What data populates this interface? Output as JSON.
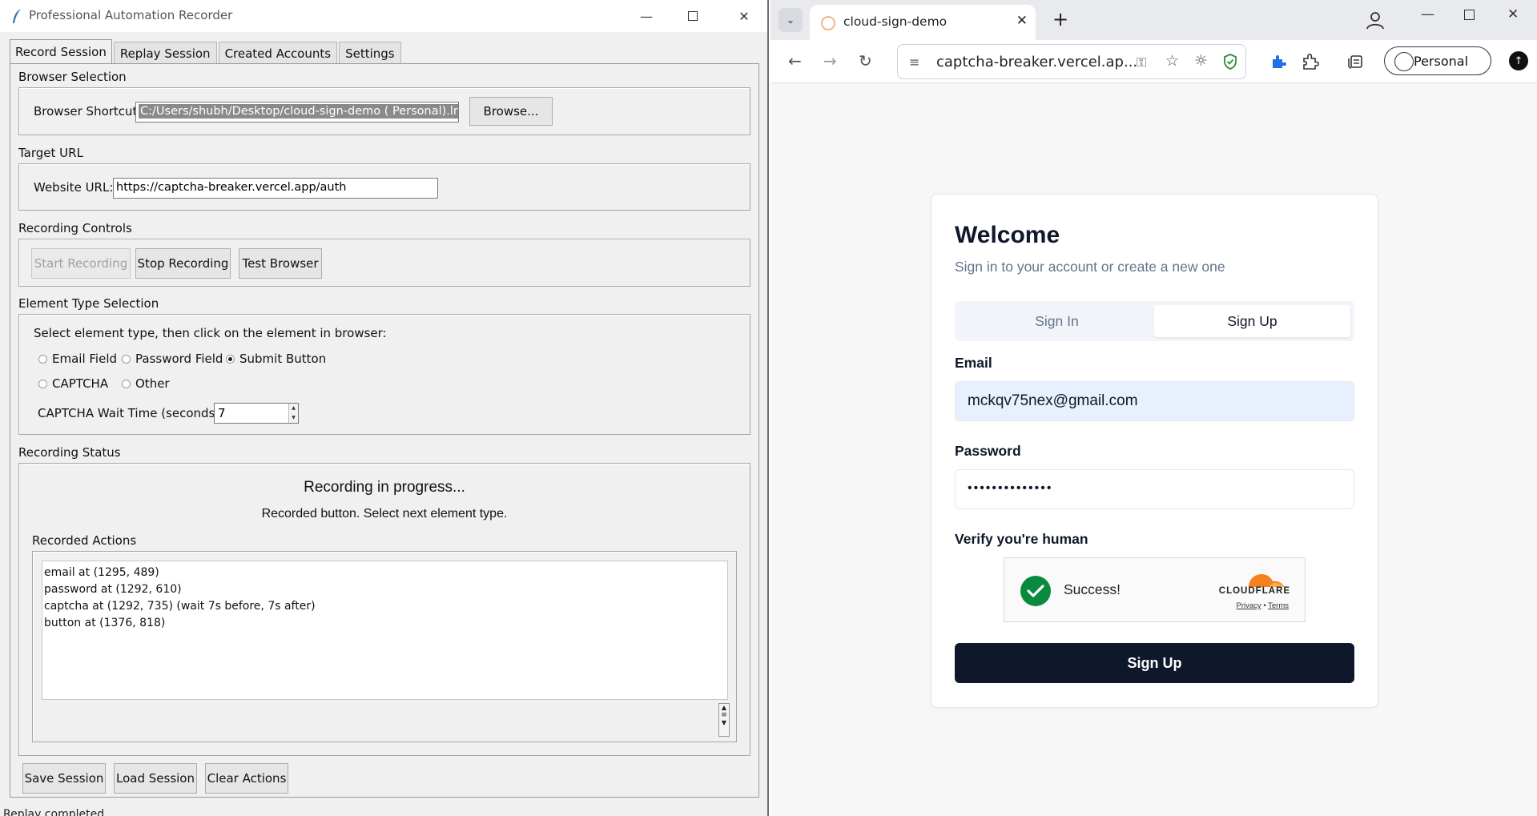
{
  "recorder": {
    "title": "Professional Automation Recorder",
    "tabs": [
      "Record Session",
      "Replay Session",
      "Created Accounts",
      "Settings"
    ],
    "browser_selection": {
      "section": "Browser Selection",
      "label": "Browser Shortcut:",
      "value": "C:/Users/shubh/Desktop/cloud-sign-demo ( Personal).lnk",
      "browse_button": "Browse..."
    },
    "target_url": {
      "section": "Target URL",
      "label": "Website URL:",
      "value": "https://captcha-breaker.vercel.app/auth"
    },
    "recording_controls": {
      "section": "Recording Controls",
      "start": "Start Recording",
      "stop": "Stop Recording",
      "test": "Test Browser"
    },
    "element_type": {
      "section": "Element Type Selection",
      "instruction": "Select element type, then click on the element in browser:",
      "options": [
        "Email Field",
        "Password Field",
        "Submit Button",
        "CAPTCHA",
        "Other"
      ],
      "selected": "Submit Button",
      "captcha_wait_label": "CAPTCHA Wait Time (seconds):",
      "captcha_wait_value": "7"
    },
    "recording_status": {
      "section": "Recording Status",
      "title": "Recording in progress...",
      "message": "Recorded button. Select next element type.",
      "actions_label": "Recorded Actions",
      "actions": [
        "email at (1295, 489)",
        "password at (1292, 610)",
        "captcha at (1292, 735) (wait 7s before, 7s after)",
        "button at (1376, 818)"
      ]
    },
    "bottom_buttons": {
      "save": "Save Session",
      "load": "Load Session",
      "clear": "Clear Actions"
    },
    "statusbar": "Replay completed"
  },
  "browser": {
    "tab_title": "cloud-sign-demo",
    "url": "captcha-breaker.vercel.ap...",
    "profile": "Personal"
  },
  "page": {
    "heading": "Welcome",
    "subtitle": "Sign in to your account or create a new one",
    "tab_signin": "Sign In",
    "tab_signup": "Sign Up",
    "active_tab": "Sign Up",
    "email_label": "Email",
    "email_value": "mckqv75nex@gmail.com",
    "password_label": "Password",
    "password_value": "••••••••••••••",
    "verify_label": "Verify you're human",
    "captcha_status": "Success!",
    "captcha_brand": "CLOUDFLARE",
    "captcha_privacy": "Privacy",
    "captcha_terms": "Terms",
    "submit": "Sign Up"
  },
  "colors": {
    "primary_button": "#0f172a",
    "success_green": "#0a8a3e",
    "cloudflare_orange": "#f48120",
    "autofill_bg": "#e8f0fe"
  }
}
